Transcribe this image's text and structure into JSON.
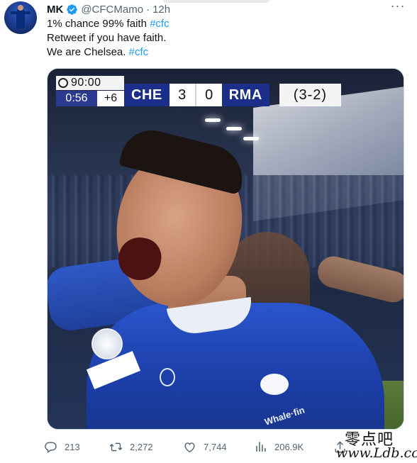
{
  "tweet": {
    "author_name": "MK",
    "handle": "@CFCMamo",
    "separator": "·",
    "time": "12h",
    "more_label": "···",
    "lines": [
      {
        "text": "1% chance 99% faith ",
        "hashtag": "#cfc"
      },
      {
        "text": "Retweet if you have faith.",
        "hashtag": ""
      },
      {
        "text": "We are Chelsea. ",
        "hashtag": "#cfc"
      }
    ]
  },
  "scoreboard": {
    "match_clock": "90:00",
    "added_clock": "0:56",
    "added_time": "+6",
    "home_team": "CHE",
    "home_score": "3",
    "away_score": "0",
    "away_team": "RMA",
    "aggregate": "(3-2)"
  },
  "jersey": {
    "sponsor": "Whale·fin"
  },
  "actions": {
    "replies": "213",
    "retweets": "2,272",
    "likes": "7,744",
    "views": "206.9K"
  },
  "watermark": {
    "chinese": "零点吧",
    "site": "www.Ldb.cc"
  },
  "colors": {
    "link": "#1d9bf0",
    "secondary_text": "#536471",
    "verified": "#1d9bf0",
    "chelsea_blue": "#1a2e8a"
  },
  "icons": {
    "verified": "verified-badge-icon",
    "more": "more-icon",
    "reply": "reply-icon",
    "retweet": "retweet-icon",
    "like": "heart-icon",
    "views": "views-icon",
    "share": "share-icon"
  }
}
